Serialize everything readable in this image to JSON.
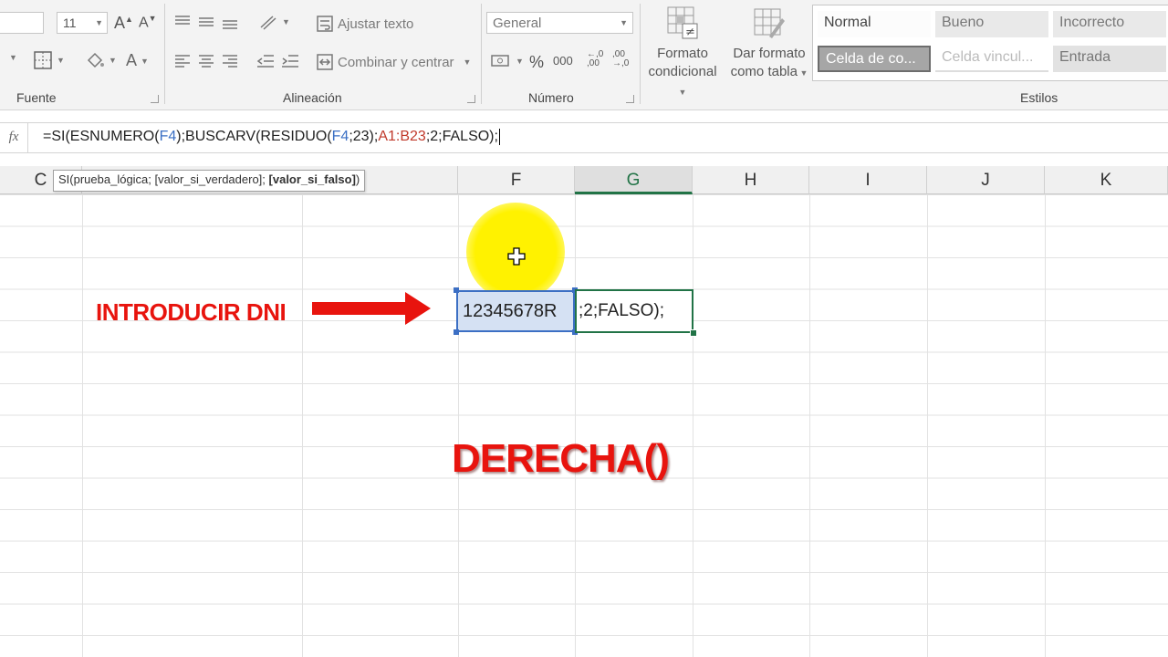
{
  "ribbon": {
    "font": {
      "size": "11",
      "group_label": "Fuente"
    },
    "alignment": {
      "wrap_text": "Ajustar texto",
      "merge_center": "Combinar y centrar",
      "group_label": "Alineación"
    },
    "number": {
      "format": "General",
      "percent": "%",
      "thousands": "000",
      "group_label": "Número"
    },
    "styles": {
      "conditional_format": [
        "Formato",
        "condicional"
      ],
      "format_as_table": [
        "Dar formato",
        "como tabla"
      ],
      "cells": [
        "Normal",
        "Bueno",
        "Incorrecto",
        "Celda de co...",
        "Celda vincul...",
        "Entrada"
      ],
      "group_label": "Estilos"
    }
  },
  "formula_bar": {
    "fx": "fx",
    "parts": [
      {
        "t": "=SI(ESNUMERO(",
        "c": "#222222"
      },
      {
        "t": "F4",
        "c": "#3a6fc4"
      },
      {
        "t": ");BUSCARV(RESIDUO(",
        "c": "#222222"
      },
      {
        "t": "F4",
        "c": "#3a6fc4"
      },
      {
        "t": ";23);",
        "c": "#222222"
      },
      {
        "t": "A1:B23",
        "c": "#c0392b"
      },
      {
        "t": ";2;FALSO);",
        "c": "#222222"
      }
    ]
  },
  "tooltip": {
    "text": "SI(prueba_lógica; [valor_si_verdadero]; ",
    "bold": "[valor_si_falso]",
    "end": ")"
  },
  "columns": [
    "C",
    "F",
    "G",
    "H",
    "I",
    "J",
    "K"
  ],
  "cells": {
    "f4": "12345678R",
    "g4": ";2;FALSO);"
  },
  "annotations": {
    "intro": "INTRODUCIR DNI",
    "derecha": "DERECHA()"
  },
  "colors": {
    "excel_green": "#217346",
    "annotation_red": "#e8140e",
    "highlight_yellow": "#fff200",
    "selection_blue": "#3c6fc4"
  }
}
